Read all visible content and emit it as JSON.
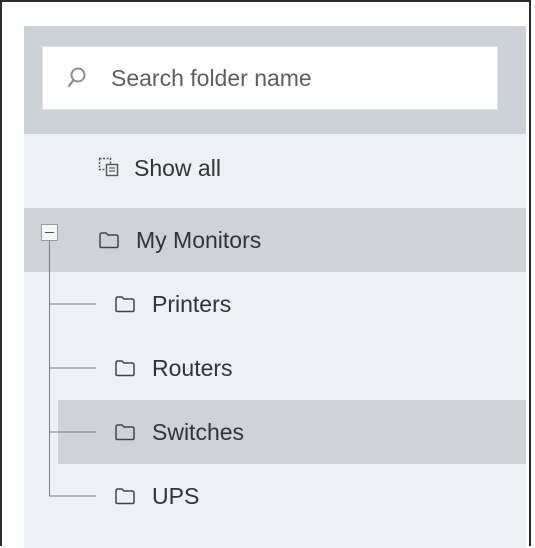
{
  "search": {
    "placeholder": "Search folder name",
    "icon": "search-icon"
  },
  "show_all": {
    "label": "Show all",
    "icon": "show-all-icon"
  },
  "tree": {
    "root": {
      "label": "My Monitors",
      "expanded": true,
      "selected": true
    },
    "children": [
      {
        "label": "Printers",
        "selected": false
      },
      {
        "label": "Routers",
        "selected": false
      },
      {
        "label": "Switches",
        "selected": true
      },
      {
        "label": "UPS",
        "selected": false
      }
    ]
  },
  "colors": {
    "panel_bg": "#edf0f4",
    "search_bar_bg": "#cdd2d8",
    "selected_row_bg": "#cfd3d8",
    "text": "#333333"
  }
}
